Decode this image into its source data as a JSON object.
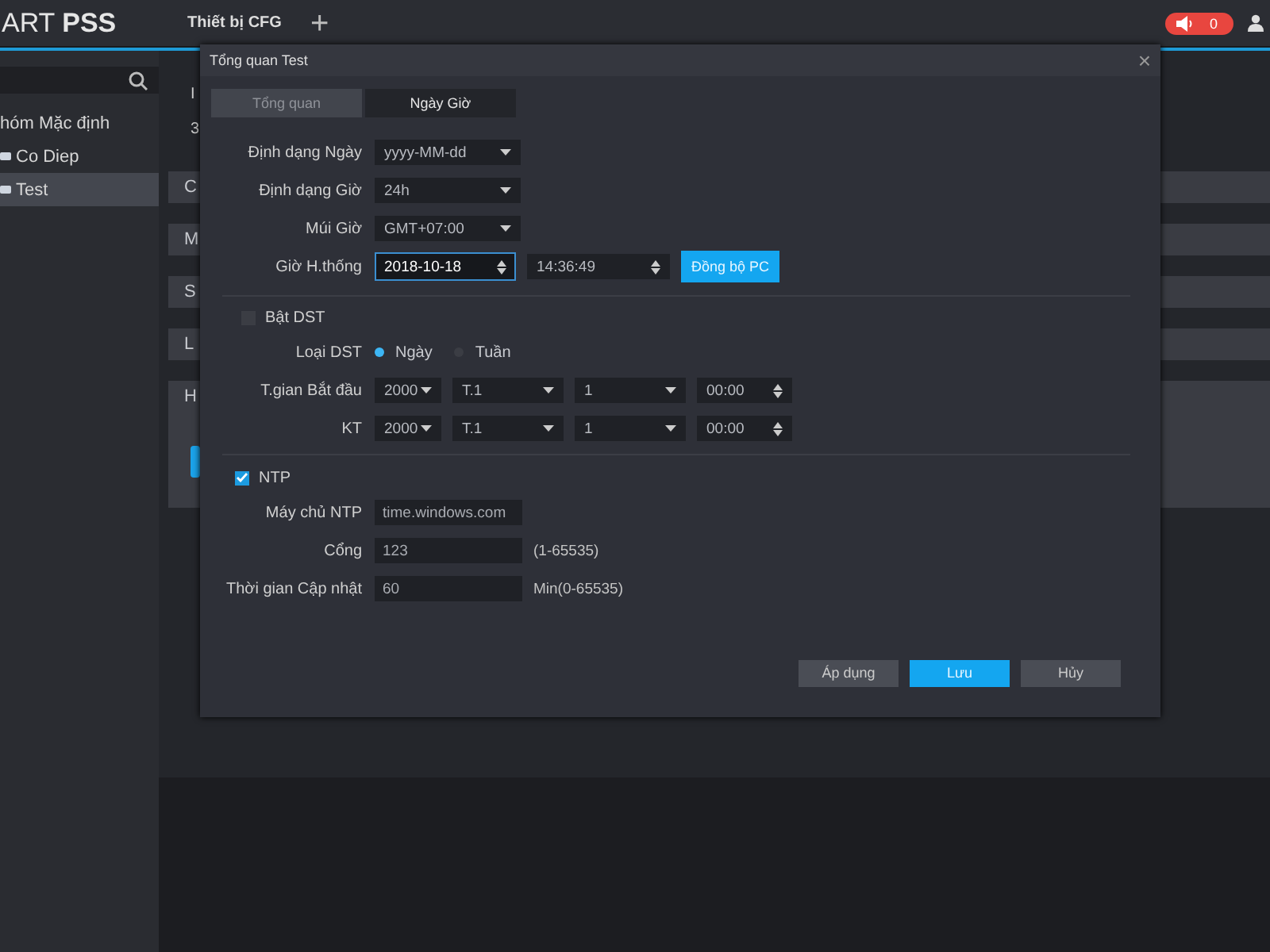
{
  "app": {
    "logo": "ART **PSS**",
    "tabs": [
      {
        "label": "Thiết bị CFG",
        "selected": true
      }
    ],
    "add_tab": "+",
    "alarm_count": "0"
  },
  "sidebar": {
    "items": [
      {
        "label": "hóm Mặc định",
        "kind": "group",
        "selected": false
      },
      {
        "label": "Co Diep",
        "kind": "device",
        "selected": false
      },
      {
        "label": "Test",
        "kind": "device",
        "selected": true
      }
    ]
  },
  "background": {
    "texts": [
      "I",
      "3"
    ],
    "rows": [
      "C",
      "M",
      "S",
      "L",
      "H"
    ]
  },
  "dialog": {
    "title": "Tổng quan Test",
    "close": "×",
    "tabs": [
      {
        "label": "Tổng quan",
        "selected": false
      },
      {
        "label": "Ngày Giờ",
        "selected": true
      }
    ],
    "format_fields": [
      {
        "label": "Định dạng Ngày",
        "value": "yyyy-MM-dd"
      },
      {
        "label": "Định dạng Giờ",
        "value": "24h"
      },
      {
        "label": "Múi Giờ",
        "value": "GMT+07:00"
      }
    ],
    "system_time": {
      "label": "Giờ H.thống",
      "date": "2018-10-18",
      "time": "14:36:49",
      "sync_button": "Đồng bộ PC"
    },
    "dst": {
      "label": "Bật DST",
      "checked": false,
      "type_label": "Loại DST",
      "types": [
        {
          "label": "Ngày",
          "selected": true
        },
        {
          "label": "Tuần",
          "selected": false
        }
      ],
      "rows": [
        {
          "label": "T.gian Bắt đầu",
          "year": "2000",
          "month": "T.1",
          "day": "1",
          "time": "00:00"
        },
        {
          "label": "KT",
          "year": "2000",
          "month": "T.1",
          "day": "1",
          "time": "00:00"
        }
      ]
    },
    "ntp": {
      "label": "NTP",
      "checked": true,
      "fields": [
        {
          "label": "Máy chủ NTP",
          "value": "time.windows.com"
        },
        {
          "label": "Cổng",
          "value": "123",
          "hint": "(1-65535)"
        },
        {
          "label": "Thời gian Cập nhật",
          "value": "60",
          "hint": "Min(0-65535)"
        }
      ]
    },
    "buttons": [
      {
        "label": "Áp dụng",
        "kind": "default"
      },
      {
        "label": "Lưu",
        "kind": "primary"
      },
      {
        "label": "Hủy",
        "kind": "default"
      }
    ]
  }
}
